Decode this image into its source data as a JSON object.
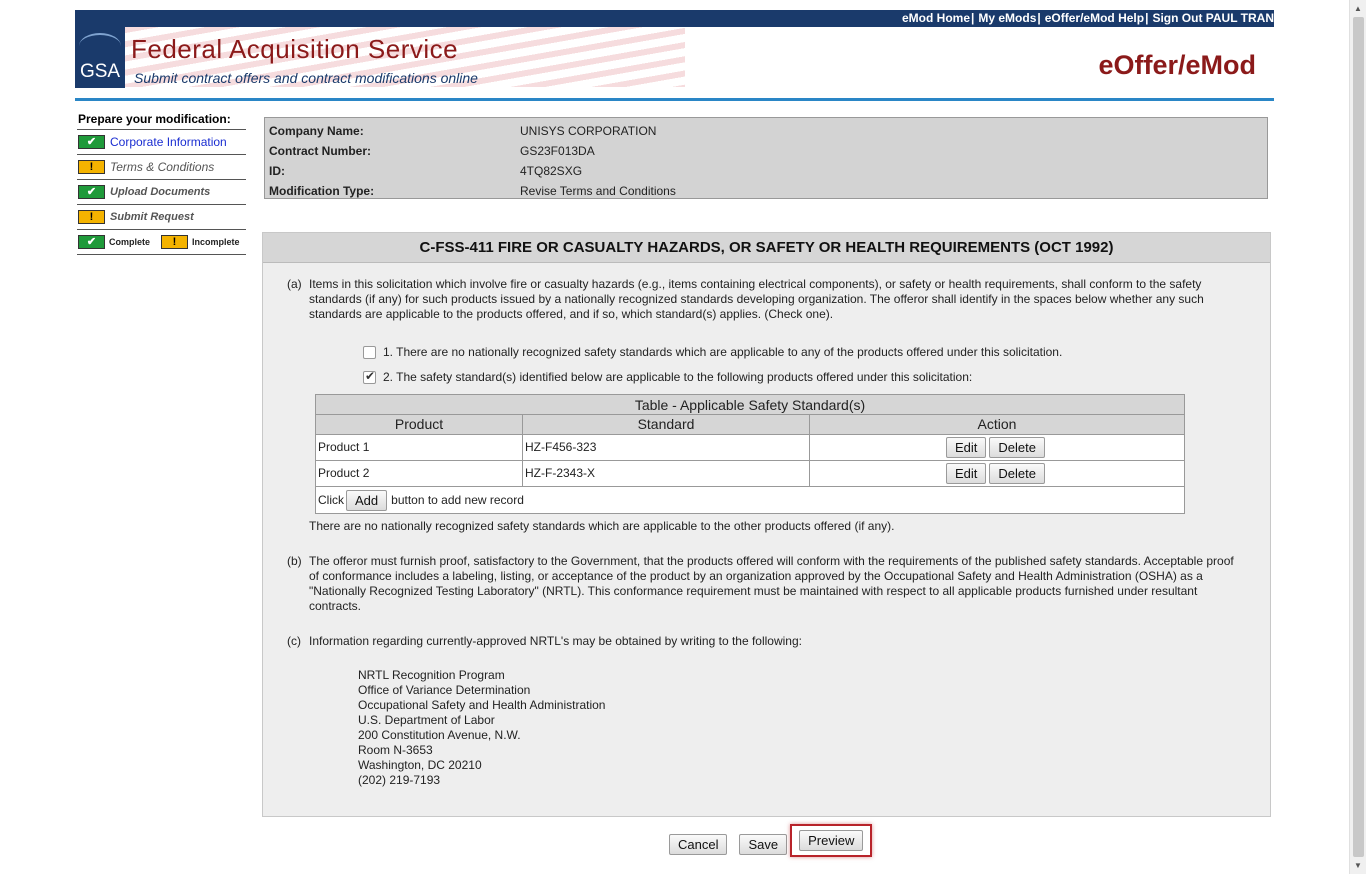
{
  "header": {
    "links": [
      "eMod Home",
      "My eMods",
      "eOffer/eMod Help",
      "Sign Out PAUL TRAN"
    ],
    "logo_text": "GSA",
    "title": "Federal Acquisition Service",
    "subtitle": "Submit contract offers and contract modifications online",
    "brand": "eOffer/eMod"
  },
  "sidebar": {
    "heading": "Prepare your modification:",
    "items": [
      {
        "label": "Corporate Information",
        "status": "complete"
      },
      {
        "label": "Terms & Conditions",
        "status": "incomplete"
      },
      {
        "label": "Upload Documents",
        "status": "complete"
      },
      {
        "label": "Submit Request",
        "status": "incomplete"
      }
    ],
    "legend": {
      "complete": "Complete",
      "incomplete": "Incomplete"
    }
  },
  "info": {
    "company_label": "Company Name:",
    "company_value": "UNISYS CORPORATION",
    "contract_label": "Contract Number:",
    "contract_value": "GS23F013DA",
    "id_label": "ID:",
    "id_value": "4TQ82SXG",
    "modtype_label": "Modification Type:",
    "modtype_value": "Revise Terms and Conditions"
  },
  "clause": {
    "title": "C-FSS-411 FIRE OR CASUALTY HAZARDS, OR SAFETY OR HEALTH REQUIREMENTS (OCT 1992)",
    "a_mark": "(a)",
    "a_text": "Items in this solicitation which involve fire or casualty hazards (e.g., items containing electrical components), or safety or health requirements, shall conform to the safety standards (if any) for such products issued by a nationally recognized standards developing organization. The offeror shall identify in the spaces below whether any such standards are applicable to the products offered, and if so, which standard(s) applies. (Check one).",
    "option1": "1. There are no nationally recognized safety standards which are applicable to any of the products offered under this solicitation.",
    "option1_checked": false,
    "option2": "2. The safety standard(s) identified below are applicable to the following products offered under this solicitation:",
    "option2_checked": true,
    "table": {
      "caption": "Table - Applicable Safety Standard(s)",
      "headers": [
        "Product",
        "Standard",
        "Action"
      ],
      "rows": [
        {
          "product": "Product 1",
          "standard": "HZ-F456-323"
        },
        {
          "product": "Product 2",
          "standard": "HZ-F-2343-X"
        }
      ],
      "edit_label": "Edit",
      "delete_label": "Delete",
      "add_prefix": "Click",
      "add_label": "Add",
      "add_suffix": "button to add new record"
    },
    "after_table": "There are no nationally recognized safety standards which are applicable to the other products offered (if any).",
    "b_mark": "(b)",
    "b_text": "The offeror must furnish proof, satisfactory to the Government, that the products offered will conform with the requirements of the published safety standards. Acceptable proof of conformance includes a labeling, listing, or acceptance of the product by an organization approved by the Occupational Safety and Health Administration (OSHA) as a \"Nationally Recognized Testing Laboratory\" (NRTL). This conformance requirement must be maintained with respect to all applicable products furnished under resultant contracts.",
    "c_mark": "(c)",
    "c_text": "Information regarding currently-approved NRTL's may be obtained by writing to the following:",
    "address": [
      "NRTL Recognition Program",
      "Office of Variance Determination",
      "Occupational Safety and Health Administration",
      "U.S. Department of Labor",
      "200 Constitution Avenue, N.W.",
      "Room N-3653",
      "Washington, DC 20210",
      "(202) 219-7193"
    ]
  },
  "footer": {
    "cancel": "Cancel",
    "save": "Save",
    "preview": "Preview"
  },
  "colors": {
    "navy": "#1a3a6b",
    "maroon": "#8b1a1a",
    "complete_green": "#1f9a3a",
    "incomplete_yellow": "#f4b300",
    "highlight_red": "#b8232a"
  }
}
